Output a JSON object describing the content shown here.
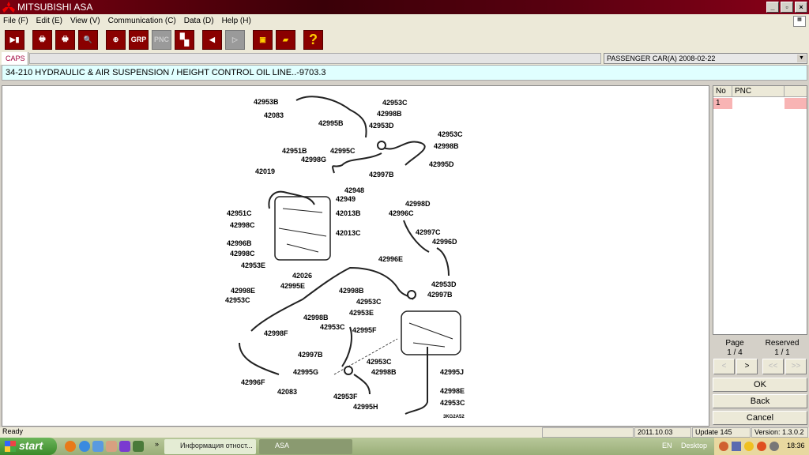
{
  "window": {
    "title": "MITSUBISHI ASA"
  },
  "menu": [
    "File (F)",
    "Edit (E)",
    "View (V)",
    "Communication (C)",
    "Data (D)",
    "Help (H)"
  ],
  "toolbar": {
    "grp": "GRP",
    "pnc": "PNC",
    "help": "?"
  },
  "tab": {
    "label": "CAPS"
  },
  "model": {
    "value": "PASSENGER CAR(A)   2008-02-22"
  },
  "info": {
    "text": "34-210  HYDRAULIC & AIR SUSPENSION / HEIGHT CONTROL OIL LINE..-9703.3"
  },
  "diagram": {
    "labels": [
      "42953B",
      "42083",
      "42995B",
      "42953C",
      "42998B",
      "42953D",
      "42953C",
      "42998B",
      "42995D",
      "42951B",
      "42995C",
      "42998G",
      "42997B",
      "42019",
      "42948",
      "42949",
      "42013B",
      "42951C",
      "42998C",
      "42013C",
      "42996B",
      "42998C",
      "42953E",
      "42026",
      "42998D",
      "42996C",
      "42997C",
      "42996D",
      "42996E",
      "42953D",
      "42997B",
      "42998E",
      "42995E",
      "42953C",
      "42998B",
      "42953C",
      "42953E",
      "42998B",
      "42953C",
      "42995F",
      "42998F",
      "42997B",
      "42953C",
      "42998B",
      "42995J",
      "42995G",
      "42996F",
      "42083",
      "42953F",
      "42998E",
      "42995H",
      "42953C"
    ],
    "code": "3KG2A52"
  },
  "pnc_list": {
    "headers": [
      "No",
      "PNC"
    ],
    "rows": [
      {
        "no": "1",
        "pnc": ""
      }
    ]
  },
  "paging": {
    "page_label": "Page",
    "page_value": "1 / 4",
    "reserved_label": "Reserved",
    "reserved_value": "1 / 1",
    "prev": "<",
    "next": ">",
    "first": "<<",
    "last": ">>"
  },
  "buttons": {
    "ok": "OK",
    "back": "Back",
    "cancel": "Cancel"
  },
  "status": {
    "text": "Ready",
    "date": "2011.10.03",
    "update": "Update 145",
    "version": "Version: 1.3.0.2"
  },
  "taskbar": {
    "start": "start",
    "more": "»",
    "tasks": [
      "Информация отност...",
      "ASA"
    ],
    "lang": "EN",
    "desktop": "Desktop",
    "clock": "18:36"
  }
}
